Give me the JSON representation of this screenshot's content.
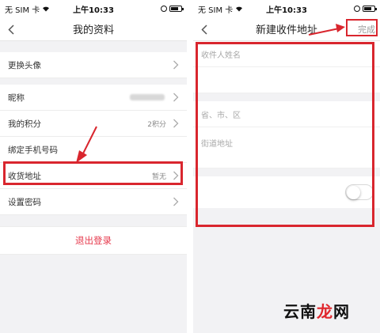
{
  "status_bar": {
    "carrier": "无 SIM 卡",
    "time": "上午10:33"
  },
  "left_screen": {
    "title": "我的资料",
    "items": [
      {
        "label": "更换头像",
        "value": ""
      },
      {
        "label": "昵称",
        "value": ""
      },
      {
        "label": "我的积分",
        "value": "2积分"
      },
      {
        "label": "绑定手机号码",
        "value": ""
      },
      {
        "label": "收货地址",
        "value": "暂无"
      },
      {
        "label": "设置密码",
        "value": ""
      }
    ],
    "logout_label": "退出登录"
  },
  "right_screen": {
    "title": "新建收件地址",
    "done_label": "完成",
    "fields": {
      "name_placeholder": "收件人姓名",
      "region_placeholder": "省、市、区",
      "street_placeholder": "街道地址"
    },
    "default_toggle_on": false
  },
  "watermark": {
    "main": "云南",
    "accent": "龙",
    "tail": "网"
  },
  "colors": {
    "highlight": "#d9262e",
    "logout": "#e6394c",
    "background": "#f2f2f4"
  }
}
